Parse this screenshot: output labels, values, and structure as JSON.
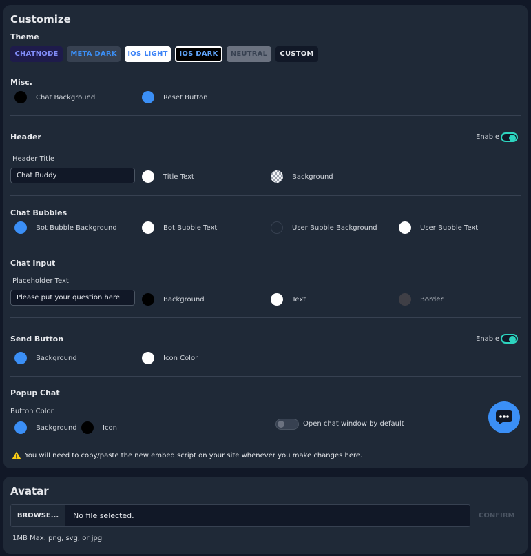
{
  "customize": {
    "title": "Customize",
    "theme_label": "Theme",
    "themes": [
      {
        "label": "CHATNODE",
        "bg": "#1e1b4b",
        "color": "#818cf8",
        "border": "#1e1b4b"
      },
      {
        "label": "META DARK",
        "bg": "#374151",
        "color": "#3b8ff6",
        "border": "#374151"
      },
      {
        "label": "IOS LIGHT",
        "bg": "#ffffff",
        "color": "#3b82f6",
        "border": "#ffffff"
      },
      {
        "label": "IOS DARK",
        "bg": "#000000",
        "color": "#60a5fa",
        "border": "#ffffff"
      },
      {
        "label": "NEUTRAL",
        "bg": "#6b7280",
        "color": "#374151",
        "border": "#6b7280"
      },
      {
        "label": "CUSTOM",
        "bg": "#111827",
        "color": "#e5e7eb",
        "border": "#111827"
      }
    ],
    "misc": {
      "title": "Misc.",
      "chat_background": {
        "label": "Chat Background",
        "color": "#000000"
      },
      "reset_button": {
        "label": "Reset Button",
        "color": "#3b8ff6"
      }
    },
    "header": {
      "title": "Header",
      "enable_label": "Enable",
      "enabled": true,
      "header_title_label": "Header Title",
      "header_title_value": "Chat Buddy",
      "title_text": {
        "label": "Title Text",
        "color": "#ffffff"
      },
      "background": {
        "label": "Background",
        "color": "transparent"
      }
    },
    "chat_bubbles": {
      "title": "Chat Bubbles",
      "bot_bubble_background": {
        "label": "Bot Bubble Background",
        "color": "#3b8ff6"
      },
      "bot_bubble_text": {
        "label": "Bot Bubble Text",
        "color": "#ffffff"
      },
      "user_bubble_background": {
        "label": "User Bubble Background",
        "color": "#1f2937"
      },
      "user_bubble_text": {
        "label": "User Bubble Text",
        "color": "#ffffff"
      }
    },
    "chat_input": {
      "title": "Chat Input",
      "placeholder_label": "Placeholder Text",
      "placeholder_value": "Please put your question here",
      "background": {
        "label": "Background",
        "color": "#000000"
      },
      "text": {
        "label": "Text",
        "color": "#ffffff"
      },
      "border": {
        "label": "Border",
        "color": "#3f3f46"
      }
    },
    "send_button": {
      "title": "Send Button",
      "enable_label": "Enable",
      "enabled": true,
      "background": {
        "label": "Background",
        "color": "#3b8ff6"
      },
      "icon_color": {
        "label": "Icon Color",
        "color": "#ffffff"
      }
    },
    "popup_chat": {
      "title": "Popup Chat",
      "button_color_label": "Button Color",
      "background": {
        "label": "Background",
        "color": "#3b8ff6"
      },
      "icon": {
        "label": "Icon",
        "color": "#000000"
      },
      "open_by_default_label": "Open chat window by default",
      "open_by_default": false
    },
    "warning": "You will need to copy/paste the new embed script on your site whenever you make changes here."
  },
  "avatar": {
    "title": "Avatar",
    "browse_label": "BROWSE...",
    "file_status": "No file selected.",
    "confirm_label": "CONFIRM",
    "hint": "1MB Max. png, svg, or jpg"
  }
}
